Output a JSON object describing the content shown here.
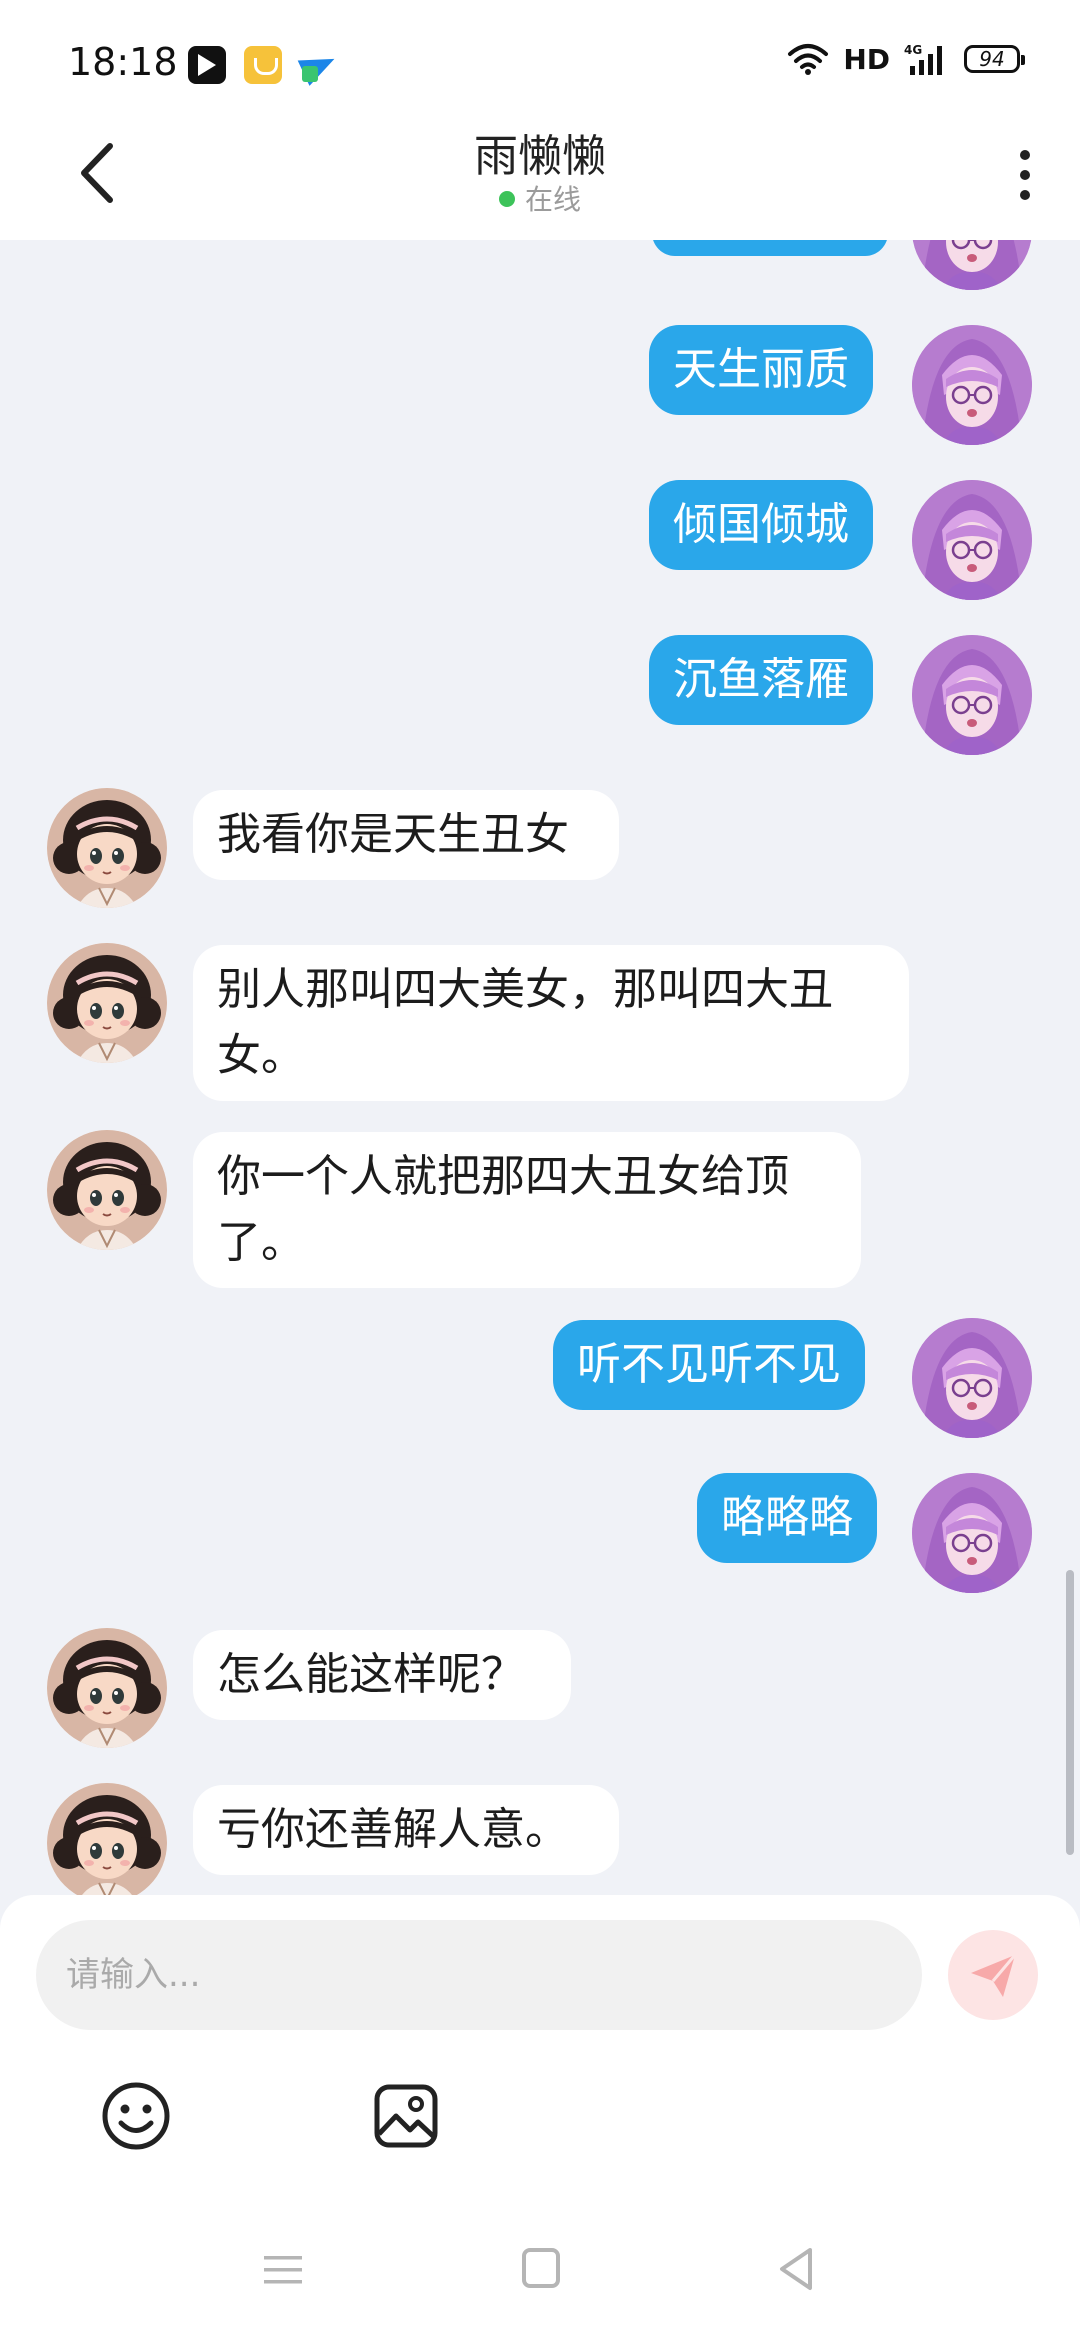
{
  "status_bar": {
    "time": "18:18",
    "network_label": "HD",
    "signal_label": "4G",
    "battery_level": "94",
    "app_icons": [
      "video-app-icon",
      "favorites-app-icon",
      "paper-plane-app-icon"
    ]
  },
  "header": {
    "title": "雨懒懒",
    "status": "在线",
    "status_color": "#3dc35a"
  },
  "messages": [
    {
      "side": "out",
      "text": ""
    },
    {
      "side": "out",
      "text": "天生丽质"
    },
    {
      "side": "out",
      "text": "倾国倾城"
    },
    {
      "side": "out",
      "text": "沉鱼落雁"
    },
    {
      "side": "in",
      "text": "我看你是天生丑女"
    },
    {
      "side": "in",
      "text": "别人那叫四大美女，那叫四大丑女。"
    },
    {
      "side": "in",
      "text": "你一个人就把那四大丑女给顶了。"
    },
    {
      "side": "out",
      "text": "听不见听不见"
    },
    {
      "side": "out",
      "text": "略略略"
    },
    {
      "side": "in",
      "text": "怎么能这样呢？"
    },
    {
      "side": "in",
      "text": "亏你还善解人意。"
    }
  ],
  "composer": {
    "placeholder": "请输入..."
  },
  "colors": {
    "outgoing_bubble": "#2aa7ea",
    "incoming_bubble": "#ffffff",
    "send_button_bg": "#fde4e4",
    "send_icon": "#f7a9a9"
  }
}
